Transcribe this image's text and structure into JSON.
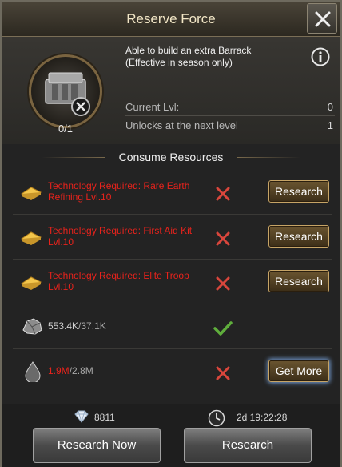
{
  "header": {
    "title": "Reserve Force"
  },
  "item": {
    "count": "0/1",
    "description_line1": "Able to build an extra Barrack",
    "description_line2": "(Effective in season only)",
    "stats": [
      {
        "label": "Current Lvl:",
        "value": "0"
      },
      {
        "label": "Unlocks at the next level",
        "value": "1"
      }
    ]
  },
  "section": {
    "title": "Consume Resources"
  },
  "requirements": [
    {
      "text": "Technology Required: Rare Earth Refining Lvl.10",
      "status": "not-met",
      "action": "Research"
    },
    {
      "text": "Technology Required: First Aid Kit Lvl.10",
      "status": "not-met",
      "action": "Research"
    },
    {
      "text": "Technology Required: Elite Troop Lvl.10",
      "status": "not-met",
      "action": "Research"
    }
  ],
  "resources": [
    {
      "icon": "ore-icon",
      "have": "553.4K",
      "need": "/37.1K",
      "status": "met"
    },
    {
      "icon": "oil-drop-icon",
      "have": "1.9M",
      "need": "/2.8M",
      "status": "not-met",
      "action": "Get More"
    }
  ],
  "footer": {
    "gem_cost": "8811",
    "time": "2d 19:22:28",
    "research_now_label": "Research Now",
    "research_label": "Research"
  },
  "colors": {
    "error": "#e8231c",
    "success": "#5fae3c",
    "accent": "#c6a466"
  }
}
